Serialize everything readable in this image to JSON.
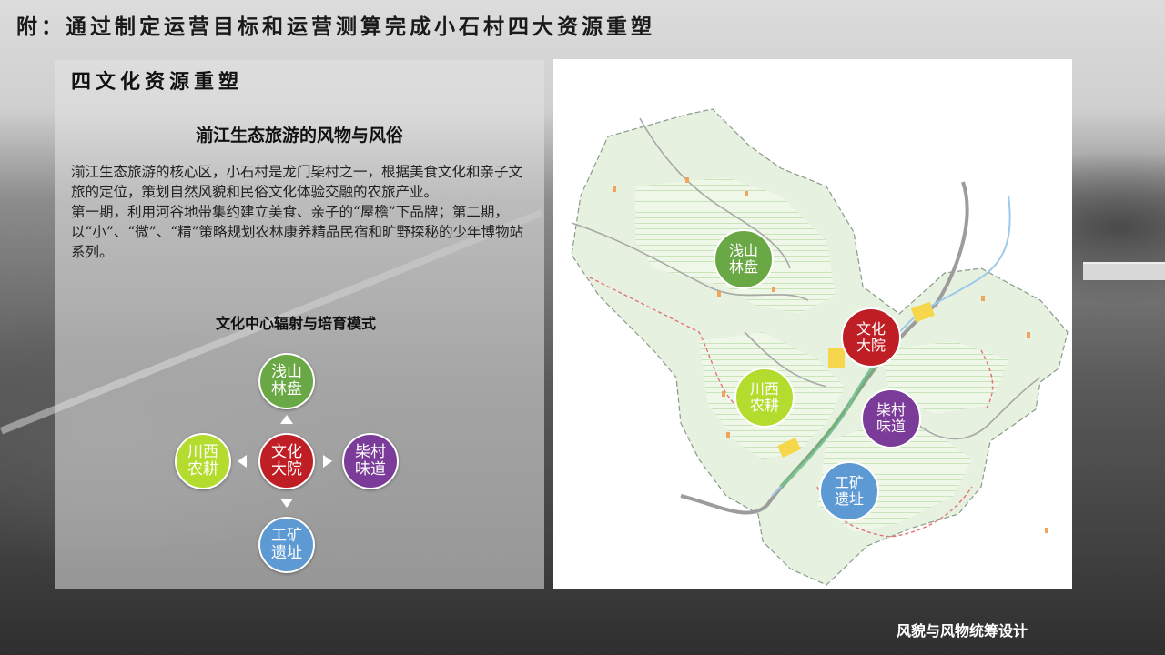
{
  "page": {
    "title": "附：通过制定运营目标和运营测算完成小石村四大资源重塑",
    "footer": "风貌与风物统筹设计"
  },
  "left_panel": {
    "heading": "四文化资源重塑",
    "subheading": "湔江生态旅游的风物与风俗",
    "paragraphs": [
      "湔江生态旅游的核心区，小石村是龙门枈村之一，根据美食文化和亲子文旅的定位，策划自然风貌和民俗文化体验交融的农旅产业。",
      "第一期，利用河谷地带集约建立美食、亲子的“屋檐”下品牌；第二期，以“小”、“微”、“精”策略规划农林康养精品民宿和旷野探秘的少年博物站系列。"
    ],
    "diagram_title": "文化中心辐射与培育模式",
    "diagram_nodes": {
      "center": "文化大院",
      "top": "浅山林盘",
      "left": "川西农耕",
      "right": "枈村味道",
      "bottom": "工矿遗址"
    }
  },
  "map": {
    "nodes": {
      "forest": "浅山林盘",
      "culture": "文化大院",
      "farming": "川西农耕",
      "taste": "枈村味道",
      "mining": "工矿遗址"
    }
  },
  "colors": {
    "green": "#6aa845",
    "lime": "#b3dc2e",
    "red": "#bf1e24",
    "purple": "#7b3b98",
    "blue": "#5d9ad4",
    "map_fill": "#e6f2df",
    "boundary": "#8a9a8a"
  }
}
